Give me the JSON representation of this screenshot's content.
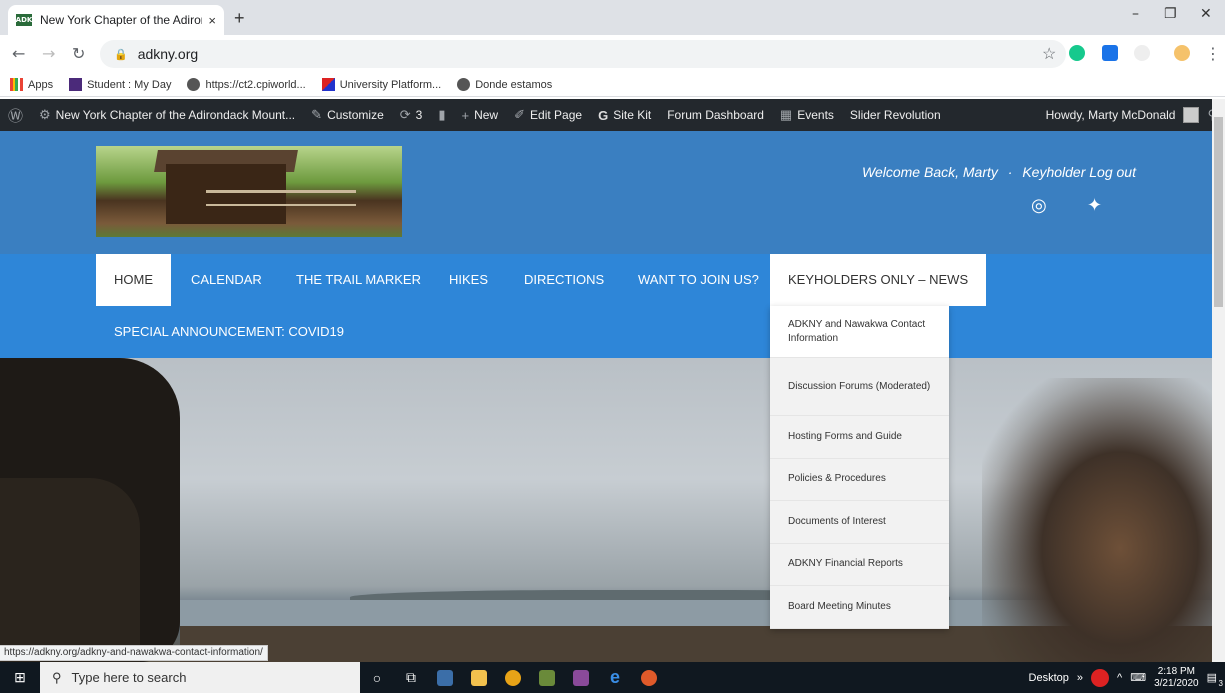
{
  "browser": {
    "tab_title": "New York Chapter of the Adironc",
    "tab_close": "×",
    "new_tab": "+",
    "favicon_text": "ADK",
    "url": "adkny.org",
    "window_minimize": "–",
    "window_restore": "❐",
    "window_close": "✕"
  },
  "bookmarks": [
    {
      "label": "Apps"
    },
    {
      "label": "Student : My Day"
    },
    {
      "label": "https://ct2.cpiworld..."
    },
    {
      "label": "University Platform..."
    },
    {
      "label": "Donde estamos"
    }
  ],
  "adminbar": {
    "site_name": "New York Chapter of the Adirondack Mount...",
    "customize": "Customize",
    "updates_count": "3",
    "new": "New",
    "edit_page": "Edit Page",
    "site_kit": "Site Kit",
    "forum_dashboard": "Forum Dashboard",
    "events": "Events",
    "slider_revolution": "Slider Revolution",
    "howdy": "Howdy, Marty McDonald"
  },
  "header": {
    "welcome": "Welcome Back, Marty",
    "separator": "·",
    "logout": "Keyholder Log out"
  },
  "nav": {
    "home": "HOME",
    "calendar": "CALENDAR",
    "trail_marker": "THE TRAIL MARKER",
    "hikes": "HIKES",
    "directions": "DIRECTIONS",
    "join": "WANT TO JOIN US?",
    "keyholders": "KEYHOLDERS ONLY – NEWS",
    "announcement": "SPECIAL ANNOUNCEMENT: COVID19"
  },
  "dropdown": [
    "ADKNY and Nawakwa Contact Information",
    "Discussion Forums (Moderated)",
    "Hosting Forms and Guide",
    "Policies & Procedures",
    "Documents of Interest",
    "ADKNY Financial Reports",
    "Board Meeting Minutes"
  ],
  "status_url": "https://adkny.org/adkny-and-nawakwa-contact-information/",
  "taskbar": {
    "search_placeholder": "Type here to search",
    "desktop": "Desktop",
    "time": "2:18 PM",
    "date": "3/21/2020",
    "notif_count": "3"
  },
  "colors": {
    "header_blue": "#3a7fc1",
    "nav_blue": "#2e86d8",
    "adminbar": "#23282d"
  }
}
